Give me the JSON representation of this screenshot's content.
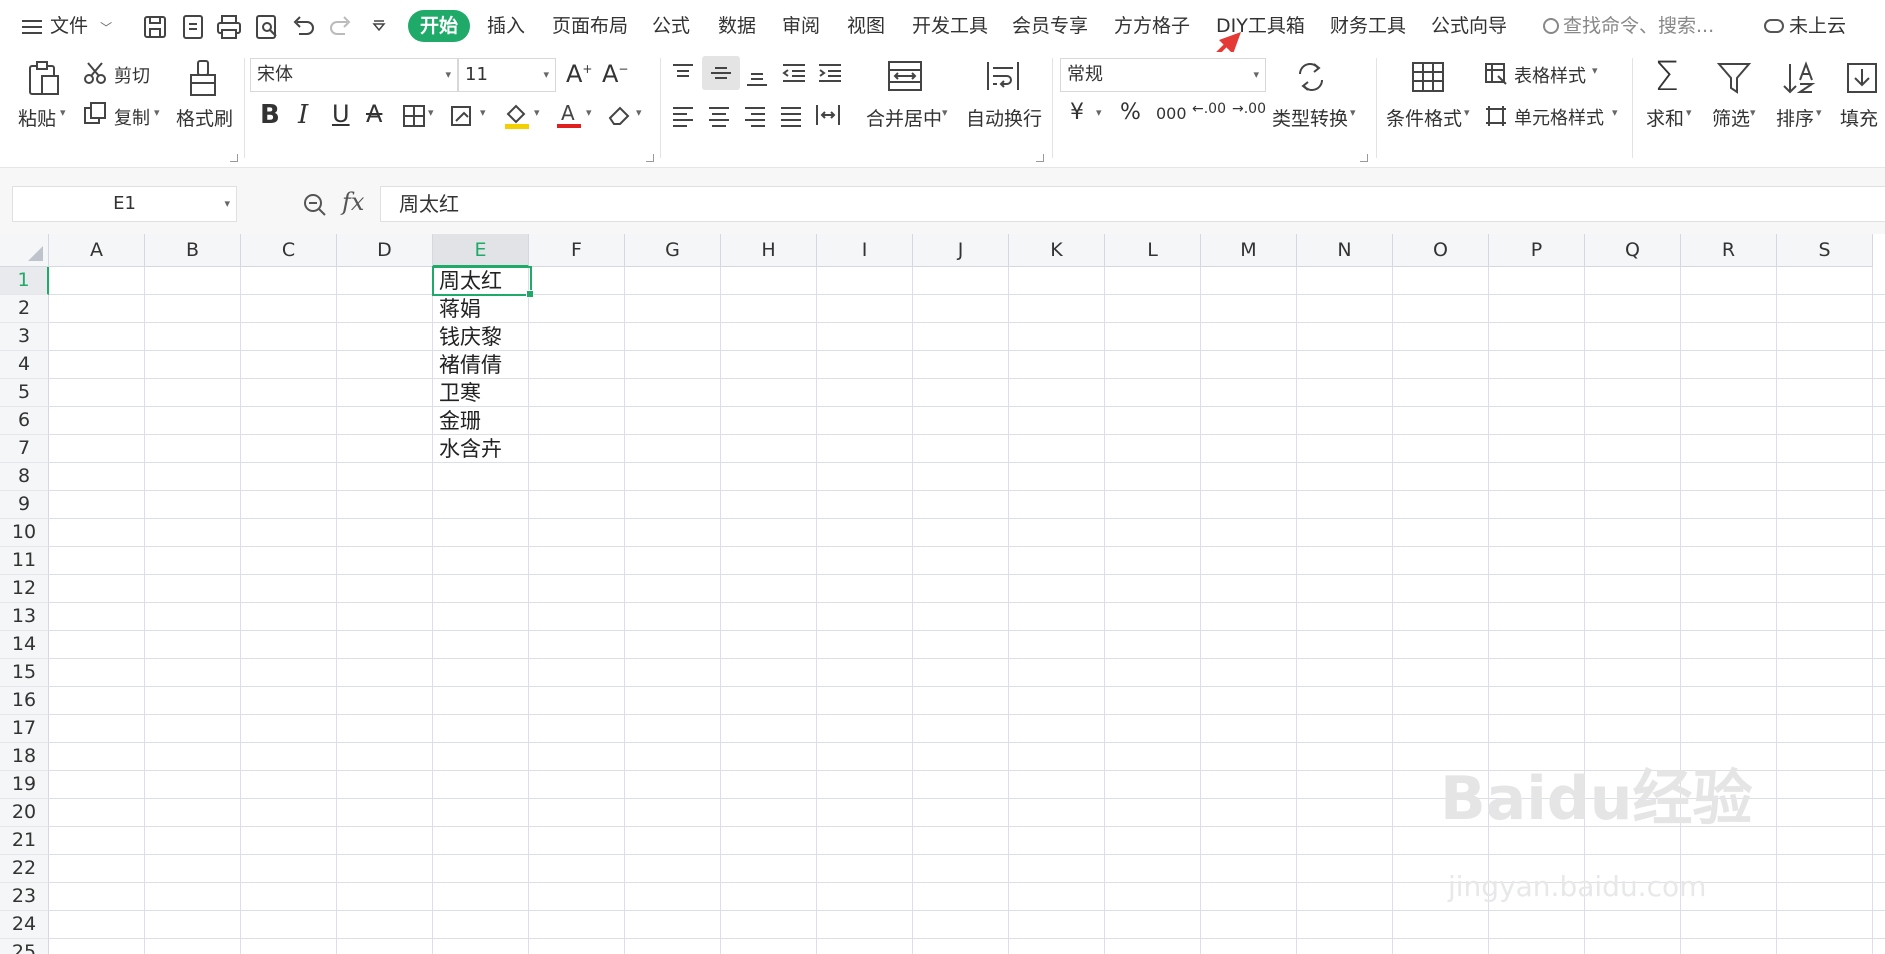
{
  "menubar": {
    "file_label": "文件",
    "tabs": [
      "开始",
      "插入",
      "页面布局",
      "公式",
      "数据",
      "审阅",
      "视图",
      "开发工具",
      "会员专享",
      "方方格子",
      "DIY工具箱",
      "财务工具",
      "公式向导"
    ],
    "search_placeholder": "查找命令、搜索...",
    "cloud_status": "未上云"
  },
  "ribbon": {
    "paste": "粘贴",
    "cut": "剪切",
    "copy": "复制",
    "format_painter": "格式刷",
    "font_name": "宋体",
    "font_size": "11",
    "merge_center": "合并居中",
    "wrap_text": "自动换行",
    "number_format": "常规",
    "type_convert": "类型转换",
    "conditional_format": "条件格式",
    "table_style": "表格样式",
    "cell_style": "单元格样式",
    "sum": "求和",
    "filter": "筛选",
    "sort": "排序",
    "fill": "填充",
    "currency_symbol": "¥",
    "percent_symbol": "%",
    "thousands_symbol": "000",
    "inc_decimal": ".00",
    "dec_decimal": ".00"
  },
  "formula_bar": {
    "cell_ref": "E1",
    "fx_label": "fx",
    "value": "周太红"
  },
  "sheet": {
    "columns": [
      "A",
      "B",
      "C",
      "D",
      "E",
      "F",
      "G",
      "H",
      "I",
      "J",
      "K",
      "L",
      "M",
      "N",
      "O",
      "P",
      "Q",
      "R",
      "S"
    ],
    "rows": [
      "1",
      "2",
      "3",
      "4",
      "5",
      "6",
      "7",
      "8",
      "9",
      "10",
      "11",
      "12",
      "13",
      "14",
      "15",
      "16",
      "17",
      "18",
      "19",
      "20",
      "21",
      "22",
      "23",
      "24",
      "25"
    ],
    "selected_column": "E",
    "selected_row": "1",
    "column_e_values": [
      "周太红",
      "蒋娟",
      "钱庆黎",
      "褚倩倩",
      "卫寒",
      "金珊",
      "水含卉"
    ]
  },
  "watermark": {
    "brand": "Baidu经验",
    "url": "jingyan.baidu.com"
  },
  "colors": {
    "accent": "#1faa6a",
    "arrow": "#e53935"
  }
}
